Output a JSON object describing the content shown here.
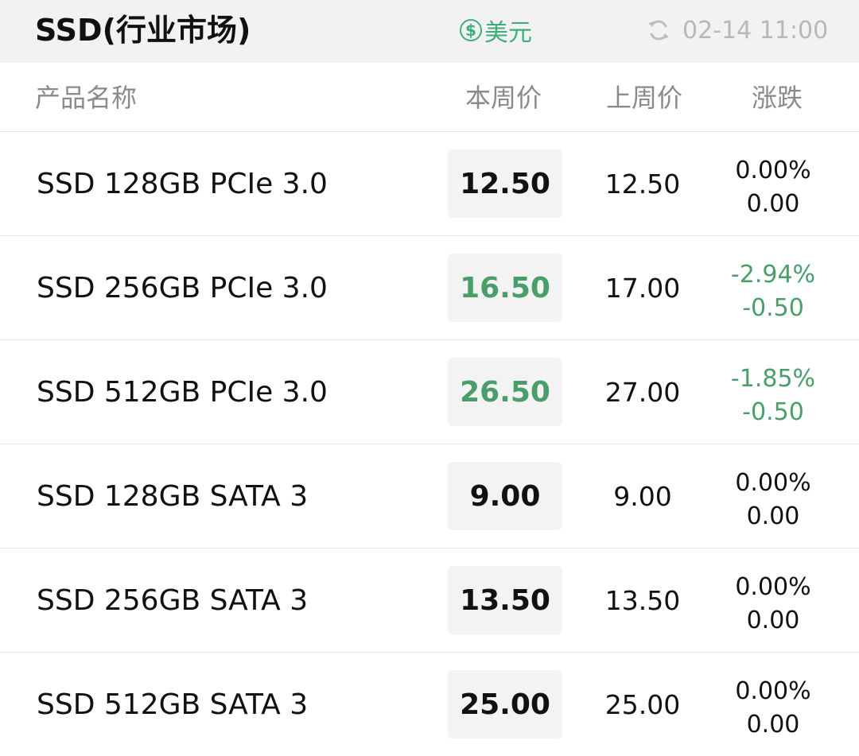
{
  "header": {
    "title": "SSD(行业市场)",
    "currency_label": "美元",
    "currency_icon": "dollar-circle-icon",
    "updated_time": "02-14 11:00",
    "refresh_icon": "refresh-icon"
  },
  "columns": {
    "name": "产品名称",
    "this_week": "本周价",
    "last_week": "上周价",
    "change": "涨跌"
  },
  "colors": {
    "accent_green": "#3fae7a",
    "down_green": "#4a9e6a",
    "neutral_text": "#111111"
  },
  "rows": [
    {
      "name": "SSD 128GB PCIe 3.0",
      "this_week": "12.50",
      "last_week": "12.50",
      "change_pct": "0.00%",
      "change_abs": "0.00",
      "trend": "flat"
    },
    {
      "name": "SSD 256GB PCIe 3.0",
      "this_week": "16.50",
      "last_week": "17.00",
      "change_pct": "-2.94%",
      "change_abs": "-0.50",
      "trend": "down"
    },
    {
      "name": "SSD 512GB PCIe 3.0",
      "this_week": "26.50",
      "last_week": "27.00",
      "change_pct": "-1.85%",
      "change_abs": "-0.50",
      "trend": "down"
    },
    {
      "name": "SSD 128GB SATA 3",
      "this_week": "9.00",
      "last_week": "9.00",
      "change_pct": "0.00%",
      "change_abs": "0.00",
      "trend": "flat"
    },
    {
      "name": "SSD 256GB SATA 3",
      "this_week": "13.50",
      "last_week": "13.50",
      "change_pct": "0.00%",
      "change_abs": "0.00",
      "trend": "flat"
    },
    {
      "name": "SSD 512GB SATA 3",
      "this_week": "25.00",
      "last_week": "25.00",
      "change_pct": "0.00%",
      "change_abs": "0.00",
      "trend": "flat"
    }
  ]
}
